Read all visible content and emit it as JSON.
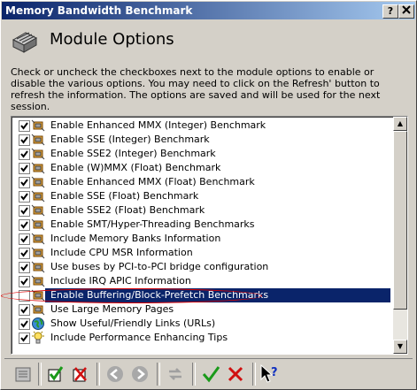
{
  "window": {
    "title": "Memory Bandwidth Benchmark"
  },
  "titlebar_buttons": {
    "help": "?",
    "close": "X"
  },
  "header": {
    "title": "Module Options"
  },
  "description": "Check or uncheck the checkboxes next to the module options to enable or disable the various options. You may need to click on the Refresh' button to refresh the information. The options are saved and will be used for the next session.",
  "options": [
    {
      "label": "Enable Enhanced MMX (Integer) Benchmark",
      "checked": true,
      "icon": "cpu-icon"
    },
    {
      "label": "Enable SSE (Integer) Benchmark",
      "checked": true,
      "icon": "cpu-icon"
    },
    {
      "label": "Enable SSE2 (Integer) Benchmark",
      "checked": true,
      "icon": "cpu-icon"
    },
    {
      "label": "Enable (W)MMX (Float) Benchmark",
      "checked": true,
      "icon": "cpu-icon"
    },
    {
      "label": "Enable Enhanced MMX (Float) Benchmark",
      "checked": true,
      "icon": "cpu-icon"
    },
    {
      "label": "Enable SSE (Float) Benchmark",
      "checked": true,
      "icon": "cpu-icon"
    },
    {
      "label": "Enable SSE2 (Float) Benchmark",
      "checked": true,
      "icon": "cpu-icon"
    },
    {
      "label": "Enable SMT/Hyper-Threading Benchmarks",
      "checked": true,
      "icon": "cpu-icon"
    },
    {
      "label": "Include Memory Banks Information",
      "checked": true,
      "icon": "cpu-icon"
    },
    {
      "label": "Include CPU MSR Information",
      "checked": true,
      "icon": "cpu-icon"
    },
    {
      "label": "Use buses by PCI-to-PCI bridge configuration",
      "checked": true,
      "icon": "cpu-icon"
    },
    {
      "label": "Include IRQ APIC Information",
      "checked": true,
      "icon": "cpu-icon"
    },
    {
      "label": "Enable Buffering/Block-Prefetch Benchmarks",
      "checked": false,
      "selected": true,
      "icon": "cpu-icon"
    },
    {
      "label": "Use Large Memory Pages",
      "checked": true,
      "icon": "cpu-icon"
    },
    {
      "label": "Show Useful/Friendly Links (URLs)",
      "checked": true,
      "icon": "globe-icon"
    },
    {
      "label": "Include Performance Enhancing Tips",
      "checked": true,
      "icon": "lightbulb-icon"
    }
  ],
  "toolbar": [
    "properties-icon",
    "check-all-icon",
    "uncheck-all-icon",
    "back-icon",
    "forward-icon",
    "refresh-icon",
    "ok-icon",
    "cancel-icon",
    "help-pointer-icon"
  ],
  "colors": {
    "selection": "#0a246a",
    "ok": "#1a9a1a",
    "cancel": "#d01010",
    "highlight_ellipse": "#dd0000"
  }
}
